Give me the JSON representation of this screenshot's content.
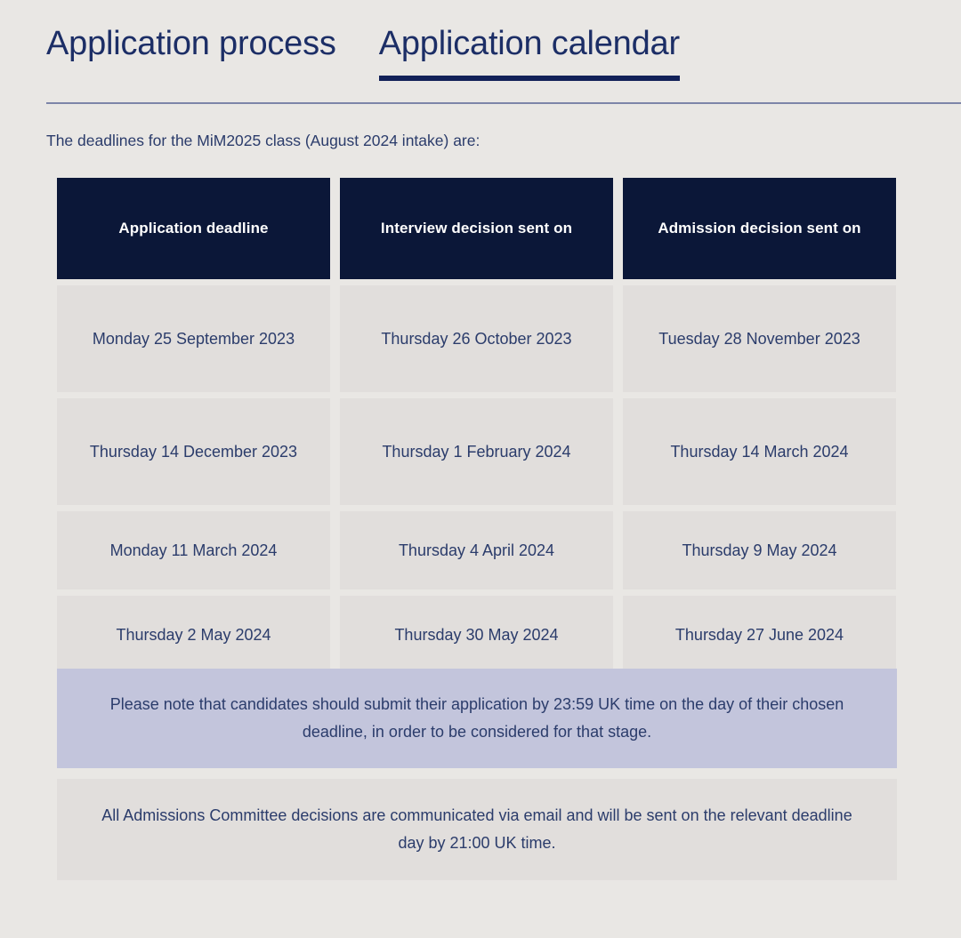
{
  "tabs": [
    {
      "label": "Application process",
      "active": false
    },
    {
      "label": "Application calendar",
      "active": true
    }
  ],
  "intro": "The deadlines for the MiM2025 class (August 2024 intake) are:",
  "table": {
    "headers": [
      "Application deadline",
      "Interview decision sent on",
      "Admission decision sent on"
    ],
    "rows": [
      [
        "Monday 25 September 2023",
        "Thursday 26 October 2023",
        "Tuesday 28 November 2023"
      ],
      [
        "Thursday 14 December 2023",
        "Thursday 1 February 2024",
        "Thursday 14 March 2024"
      ],
      [
        "Monday 11 March 2024",
        "Thursday 4 April 2024",
        "Thursday 9 May 2024"
      ],
      [
        "Thursday 2 May 2024",
        "Thursday 30 May 2024",
        "Thursday 27 June 2024"
      ]
    ]
  },
  "notes": {
    "highlight": "Please note that candidates should submit their application by 23:59 UK time on the day of their chosen deadline, in order to be considered for that stage.",
    "plain": "All Admissions Committee decisions are communicated via email and will be sent on the relevant deadline day by 21:00 UK time."
  },
  "colors": {
    "page_background": "#E9E7E4",
    "cell_background": "#E1DEDC",
    "header_navy": "#0B1738",
    "text_navy": "#2B3C6B",
    "accent_underline": "#122158",
    "highlight_note": "#C3C5DC",
    "rule": "#7D85A8"
  }
}
